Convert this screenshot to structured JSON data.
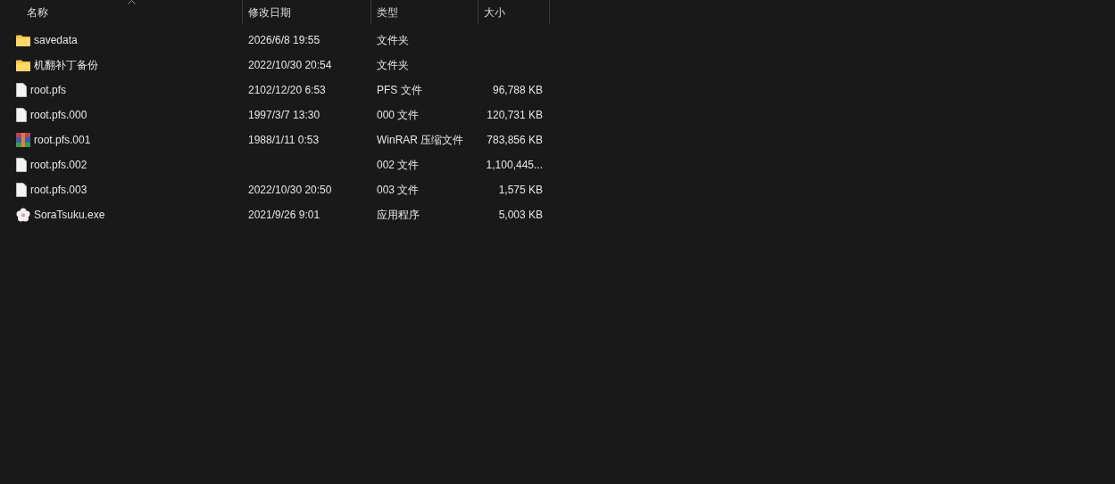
{
  "columns": [
    {
      "label": "名称"
    },
    {
      "label": "修改日期"
    },
    {
      "label": "类型"
    },
    {
      "label": "大小"
    }
  ],
  "rows": [
    {
      "kind": "folder",
      "name": "savedata",
      "date": "2026/6/8 19:55",
      "type": "文件夹"
    },
    {
      "kind": "folder",
      "name": "机翻补丁备份",
      "date": "2022/10/30 20:54",
      "type": "文件夹"
    },
    {
      "kind": "file",
      "name": "root.pfs",
      "date": "2102/12/20 6:53",
      "type": "PFS 文件",
      "size": "96,788 KB"
    },
    {
      "kind": "file",
      "name": "root.pfs.000",
      "date": "1997/3/7 13:30",
      "type": "000 文件",
      "size": "120,731 KB"
    },
    {
      "kind": "archive",
      "name": "root.pfs.001",
      "date": "1988/1/11 0:53",
      "type": "WinRAR 压缩文件",
      "size": "783,856 KB"
    },
    {
      "kind": "file",
      "name": "root.pfs.002",
      "type": "002 文件",
      "size": "1,100,445..."
    },
    {
      "kind": "file",
      "name": "root.pfs.003",
      "date": "2022/10/30 20:50",
      "type": "003 文件",
      "size": "1,575 KB"
    },
    {
      "kind": "app",
      "name": "SoraTsuku.exe",
      "date": "2021/9/26 9:01",
      "type": "应用程序",
      "size": "5,003 KB"
    }
  ]
}
